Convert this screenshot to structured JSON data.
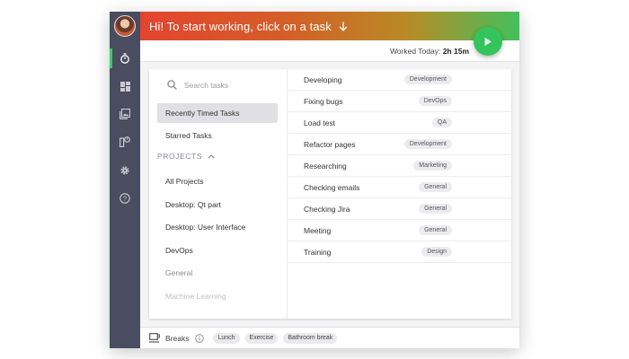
{
  "header": {
    "greeting": "Hi! To start working, click on a task",
    "worked_label": "Worked Today:",
    "worked_value": "2h 15m"
  },
  "sidebar": {
    "items": [
      {
        "icon": "stopwatch-icon",
        "active": true
      },
      {
        "icon": "dashboard-icon",
        "active": false
      },
      {
        "icon": "gallery-icon",
        "active": false
      },
      {
        "icon": "reports-icon",
        "active": false
      },
      {
        "icon": "gear-icon",
        "active": false
      },
      {
        "icon": "help-icon",
        "active": false
      }
    ]
  },
  "left_panel": {
    "search_placeholder": "Search tasks",
    "recently_timed": "Recently Timed Tasks",
    "starred": "Starred Tasks",
    "projects_header": "PROJECTS",
    "projects": [
      "All Projects",
      "Desktop: Qt part",
      "Desktop: User Interface",
      "DevOps",
      "General",
      "Machine Learning"
    ]
  },
  "tasks": [
    {
      "name": "Developing",
      "tag": "Development"
    },
    {
      "name": "Fixing bugs",
      "tag": "DevOps"
    },
    {
      "name": "Load test",
      "tag": "QA"
    },
    {
      "name": "Refactor pages",
      "tag": "Development"
    },
    {
      "name": "Researching",
      "tag": "Marketing"
    },
    {
      "name": "Checking emails",
      "tag": "General"
    },
    {
      "name": "Checking Jira",
      "tag": "General"
    },
    {
      "name": "Meeting",
      "tag": "General"
    },
    {
      "name": "Training",
      "tag": "Design"
    }
  ],
  "footer": {
    "breaks_label": "Breaks",
    "breaks": [
      "Lunch",
      "Exercise",
      "Bathroom break"
    ]
  },
  "colors": {
    "accent_green": "#33c45c",
    "header_start": "#e4442f",
    "sidebar_bg": "#4a4c5f"
  }
}
